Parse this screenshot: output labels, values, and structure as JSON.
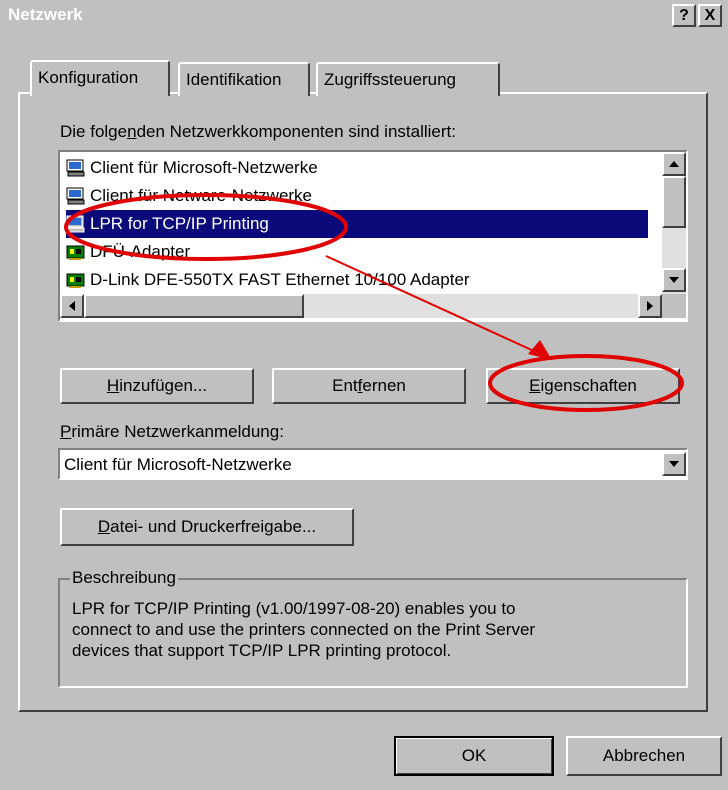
{
  "window": {
    "title": "Netzwerk",
    "help_glyph": "?",
    "close_glyph": "X"
  },
  "tabs": [
    {
      "label": "Konfiguration",
      "active": true
    },
    {
      "label": "Identifikation",
      "active": false
    },
    {
      "label": "Zugriffssteuerung",
      "active": false
    }
  ],
  "components": {
    "label_pre": "Die folge",
    "label_u": "n",
    "label_post": "den Netzwerkkomponenten sind installiert:",
    "items": [
      {
        "label": "Client für Microsoft-Netzwerke",
        "icon": "computer-icon",
        "selected": false
      },
      {
        "label": "Client für Netware-Netzwerke",
        "icon": "computer-icon",
        "selected": false
      },
      {
        "label": "LPR for TCP/IP Printing",
        "icon": "computer-icon",
        "selected": true
      },
      {
        "label": "DFÜ-Adapter",
        "icon": "network-adapter-icon",
        "selected": false
      },
      {
        "label": "D-Link DFE-550TX FAST Ethernet 10/100 Adapter",
        "icon": "network-adapter-icon",
        "selected": false
      }
    ]
  },
  "buttons": {
    "add": {
      "u": "H",
      "rest": "inzufügen..."
    },
    "remove": {
      "pre": "Ent",
      "u": "f",
      "rest": "ernen"
    },
    "properties": {
      "u": "E",
      "rest": "igenschaften"
    }
  },
  "logon": {
    "label_u": "P",
    "label_rest": "rimäre Netzwerkanmeldung:",
    "value": "Client für Microsoft-Netzwerke"
  },
  "sharing_button": {
    "u": "D",
    "rest": "atei- und Druckerfreigabe..."
  },
  "description": {
    "legend": "Beschreibung",
    "lines": [
      "LPR for TCP/IP Printing (v1.00/1997-08-20) enables you to",
      "connect to and use the printers connected on the Print Server",
      "devices that support TCP/IP LPR printing protocol."
    ]
  },
  "footer": {
    "ok": "OK",
    "cancel": "Abbrechen"
  },
  "annotation_color": "#e00000"
}
